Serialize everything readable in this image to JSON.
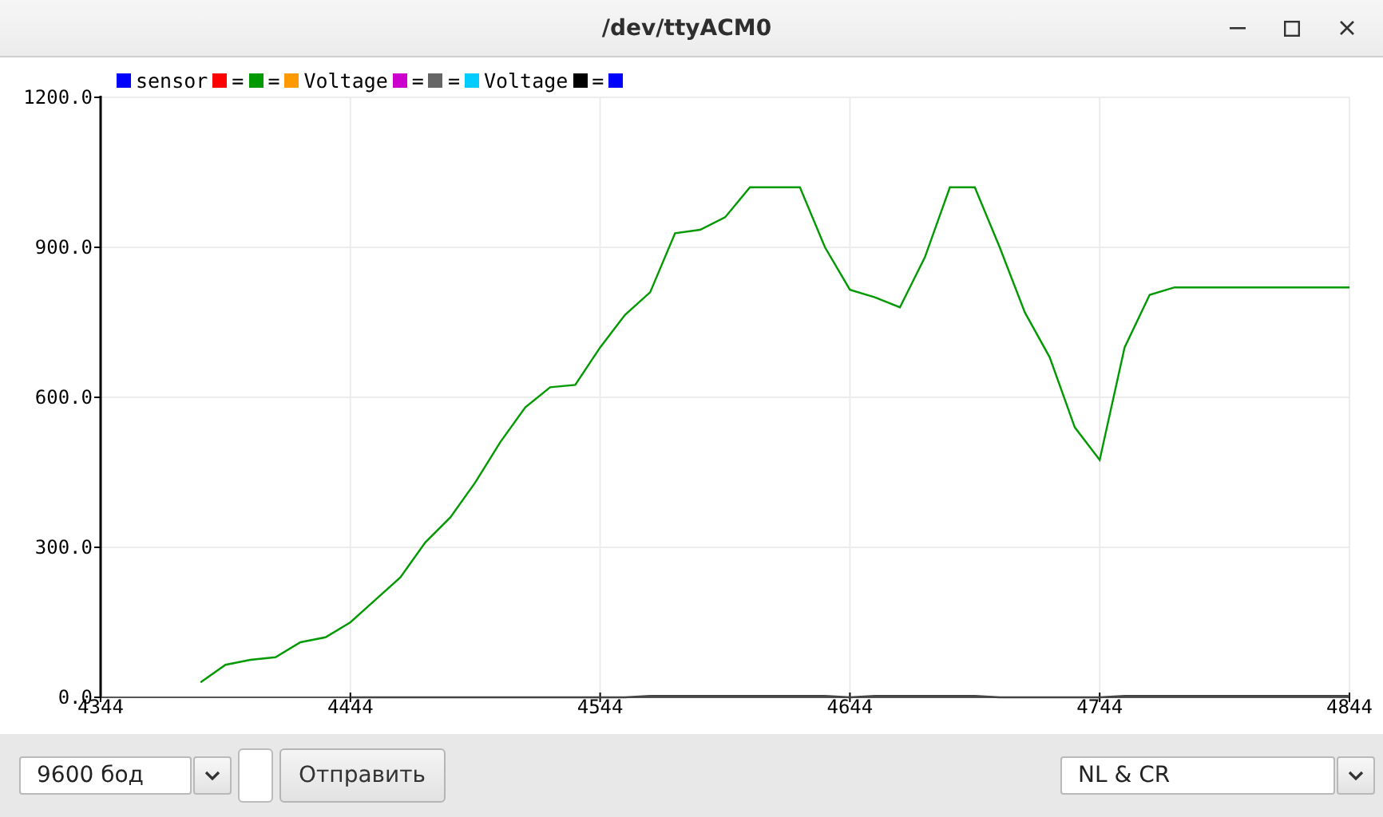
{
  "window": {
    "title": "/dev/ttyACM0"
  },
  "legend": [
    {
      "label": "sensor",
      "color": "#0000ff"
    },
    {
      "label": "=",
      "color": "#ff0000"
    },
    {
      "label": "=",
      "color": "#009900"
    },
    {
      "label": "Voltage",
      "color": "#ff9900"
    },
    {
      "label": "=",
      "color": "#cc00cc"
    },
    {
      "label": "=",
      "color": "#666666"
    },
    {
      "label": "Voltage",
      "color": "#00ccff"
    },
    {
      "label": "=",
      "color": "#000000"
    },
    {
      "color": "#0000ff"
    }
  ],
  "plot": {
    "chart_data": {
      "type": "line",
      "grid": true,
      "xlim": [
        4344,
        4844
      ],
      "ylim": [
        0,
        1200
      ],
      "xticks": [
        4344,
        4444,
        4544,
        4644,
        4744,
        4844
      ],
      "yticks": [
        {
          "value": 0,
          "label": "0.0"
        },
        {
          "value": 300,
          "label": "300.0"
        },
        {
          "value": 600,
          "label": "600.0"
        },
        {
          "value": 900,
          "label": "900.0"
        },
        {
          "value": 1200,
          "label": "1200.0"
        }
      ],
      "x": [
        4384,
        4394,
        4404,
        4414,
        4424,
        4434,
        4444,
        4454,
        4464,
        4474,
        4484,
        4494,
        4504,
        4514,
        4524,
        4534,
        4544,
        4554,
        4564,
        4574,
        4584,
        4594,
        4604,
        4614,
        4624,
        4634,
        4644,
        4654,
        4664,
        4674,
        4684,
        4694,
        4704,
        4714,
        4724,
        4734,
        4744,
        4754,
        4764,
        4774,
        4784,
        4794,
        4804,
        4814,
        4824,
        4834,
        4844
      ],
      "series": [
        {
          "color": "#009900",
          "values": [
            30,
            65,
            75,
            80,
            110,
            120,
            150,
            195,
            240,
            310,
            360,
            430,
            510,
            580,
            620,
            625,
            700,
            765,
            810,
            928,
            935,
            960,
            1020,
            1020,
            1020,
            900,
            815,
            800,
            780,
            880,
            1020,
            1020,
            900,
            770,
            680,
            540,
            475,
            700,
            805,
            820,
            820,
            820,
            820,
            820,
            820,
            820,
            820
          ]
        },
        {
          "color": "#444444",
          "values": [
            null,
            null,
            null,
            null,
            null,
            null,
            0,
            0,
            0,
            0,
            0,
            0,
            0,
            0,
            0,
            0,
            0,
            0,
            3,
            3,
            3,
            3,
            3,
            3,
            3,
            3,
            0,
            3,
            3,
            3,
            3,
            3,
            0,
            0,
            0,
            0,
            0,
            3,
            3,
            3,
            3,
            3,
            3,
            3,
            3,
            3,
            3
          ]
        }
      ]
    }
  },
  "controls": {
    "baud_rate": "9600 бод",
    "send_button": "Отправить",
    "line_ending": "NL & CR"
  }
}
